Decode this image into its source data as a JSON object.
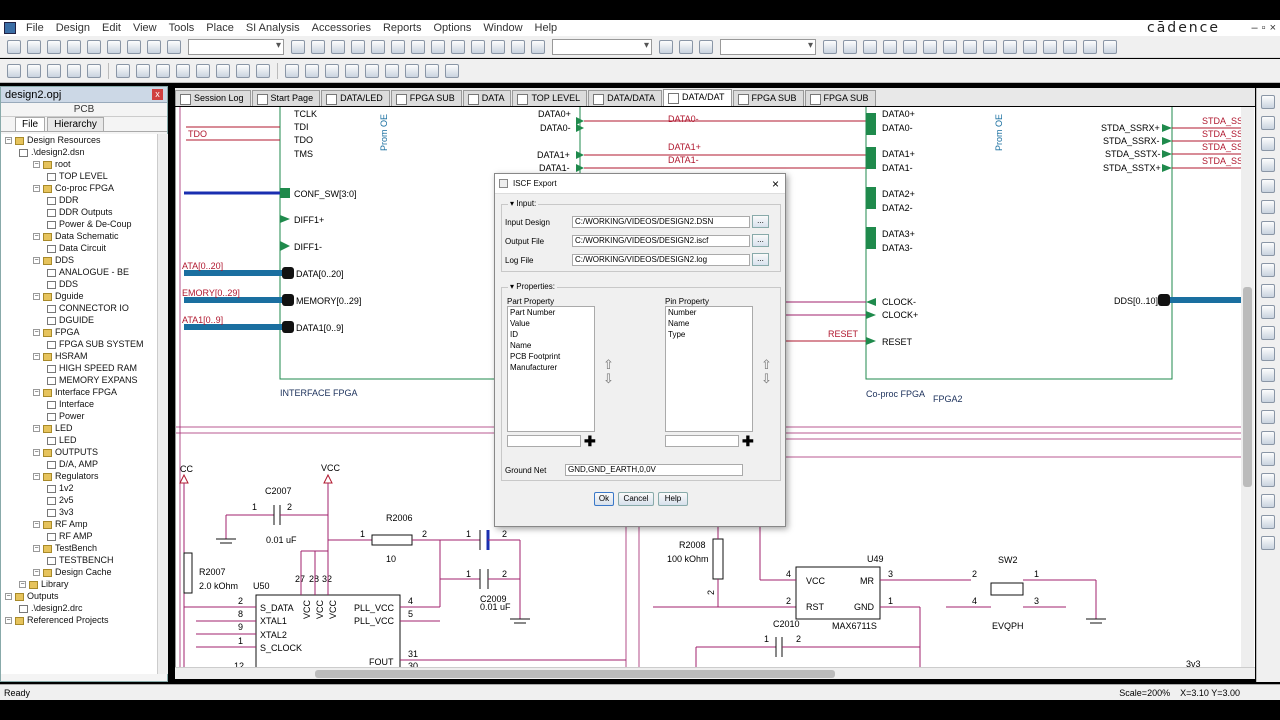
{
  "menu": {
    "items": [
      "File",
      "Design",
      "Edit",
      "View",
      "Tools",
      "Place",
      "SI Analysis",
      "Accessories",
      "Reports",
      "Options",
      "Window",
      "Help"
    ],
    "brand": "cādence"
  },
  "project": {
    "title": "design2.opj",
    "subtitle": "PCB",
    "tabs": [
      "File",
      "Hierarchy"
    ],
    "tree": [
      {
        "indent": 0,
        "label": "Design Resources",
        "icon": "folder"
      },
      {
        "indent": 1,
        "label": ".\\design2.dsn",
        "icon": "page"
      },
      {
        "indent": 2,
        "label": "root",
        "icon": "folder"
      },
      {
        "indent": 3,
        "label": "TOP LEVEL",
        "icon": "page"
      },
      {
        "indent": 2,
        "label": "Co-proc FPGA",
        "icon": "folder"
      },
      {
        "indent": 3,
        "label": "DDR",
        "icon": "page"
      },
      {
        "indent": 3,
        "label": "DDR Outputs",
        "icon": "page"
      },
      {
        "indent": 3,
        "label": "Power & De-Coup",
        "icon": "page"
      },
      {
        "indent": 2,
        "label": "Data Schematic",
        "icon": "folder"
      },
      {
        "indent": 3,
        "label": "Data Circuit",
        "icon": "page"
      },
      {
        "indent": 2,
        "label": "DDS",
        "icon": "folder"
      },
      {
        "indent": 3,
        "label": "ANALOGUE -  BE",
        "icon": "page"
      },
      {
        "indent": 3,
        "label": "DDS",
        "icon": "page"
      },
      {
        "indent": 2,
        "label": "Dguide",
        "icon": "folder"
      },
      {
        "indent": 3,
        "label": "CONNECTOR IO",
        "icon": "page"
      },
      {
        "indent": 3,
        "label": "DGUIDE",
        "icon": "page"
      },
      {
        "indent": 2,
        "label": "FPGA",
        "icon": "folder"
      },
      {
        "indent": 3,
        "label": "FPGA SUB SYSTEM",
        "icon": "page"
      },
      {
        "indent": 2,
        "label": "HSRAM",
        "icon": "folder"
      },
      {
        "indent": 3,
        "label": "HIGH SPEED RAM",
        "icon": "page"
      },
      {
        "indent": 3,
        "label": "MEMORY EXPANS",
        "icon": "page"
      },
      {
        "indent": 2,
        "label": "Interface FPGA",
        "icon": "folder"
      },
      {
        "indent": 3,
        "label": "Interface",
        "icon": "page"
      },
      {
        "indent": 3,
        "label": "Power",
        "icon": "page"
      },
      {
        "indent": 2,
        "label": "LED",
        "icon": "folder"
      },
      {
        "indent": 3,
        "label": "LED",
        "icon": "page"
      },
      {
        "indent": 2,
        "label": "OUTPUTS",
        "icon": "folder"
      },
      {
        "indent": 3,
        "label": "D/A, AMP",
        "icon": "page"
      },
      {
        "indent": 2,
        "label": "Regulators",
        "icon": "folder"
      },
      {
        "indent": 3,
        "label": "1v2",
        "icon": "page"
      },
      {
        "indent": 3,
        "label": "2v5",
        "icon": "page"
      },
      {
        "indent": 3,
        "label": "3v3",
        "icon": "page"
      },
      {
        "indent": 2,
        "label": "RF Amp",
        "icon": "folder"
      },
      {
        "indent": 3,
        "label": "RF AMP",
        "icon": "page"
      },
      {
        "indent": 2,
        "label": "TestBench",
        "icon": "folder"
      },
      {
        "indent": 3,
        "label": "TESTBENCH",
        "icon": "page"
      },
      {
        "indent": 2,
        "label": "Design Cache",
        "icon": "folder"
      },
      {
        "indent": 1,
        "label": "Library",
        "icon": "folder"
      },
      {
        "indent": 0,
        "label": "Outputs",
        "icon": "folder"
      },
      {
        "indent": 1,
        "label": ".\\design2.drc",
        "icon": "page"
      },
      {
        "indent": 0,
        "label": "Referenced Projects",
        "icon": "folder"
      }
    ]
  },
  "tabs": [
    "Session Log",
    "Start Page",
    "DATA/LED",
    "FPGA SUB",
    "DATA",
    "TOP LEVEL",
    "DATA/DATA",
    "DATA/DAT",
    "FPGA SUB",
    "FPGA SUB"
  ],
  "active_tab_index": 7,
  "schematic": {
    "left_block_pins": [
      "TCLK",
      "TDI",
      "TDO",
      "TMS"
    ],
    "left_block_nets": [
      "TDO"
    ],
    "left_pins2": [
      "CONF_SW[3:0]",
      "DIFF1+",
      "DIFF1-",
      "DATA[0..20]",
      "MEMORY[0..29]",
      "DATA1[0..9]"
    ],
    "left_bus_labels": [
      "ATA[0..20]",
      "EMORY[0..29]",
      "ATA1[0..9]"
    ],
    "left_block_name": "INTERFACE FPGA",
    "left_block_vlabel": "Prom OE",
    "mid_pins": [
      "DATA0+",
      "DATA0-",
      "DATA1+",
      "DATA1-"
    ],
    "mid_nets": [
      "DATA0-",
      "DATA1+",
      "DATA1-"
    ],
    "right_block_pins_left": [
      "DATA0+",
      "DATA0-",
      "DATA1+",
      "DATA1-",
      "DATA2+",
      "DATA2-",
      "DATA3+",
      "DATA3-",
      "CLOCK-",
      "CLOCK+",
      "RESET"
    ],
    "right_block_pins_right": [
      "STDA_SSRX+",
      "STDA_SSRX-",
      "STDA_SSTX-",
      "STDA_SSTX+",
      "DDS[0..10]"
    ],
    "right_nets": [
      "STDA_SS",
      "STDA_SS",
      "STDA_SS",
      "STDA_SS"
    ],
    "reset_net": "RESET",
    "right_block_name": "Co-proc FPGA",
    "right_block_ref": "FPGA2",
    "right_block_vlabel": "Prom OE",
    "c2007": {
      "ref": "C2007",
      "value": "0.01 uF",
      "pin1": "1",
      "pin2": "2"
    },
    "vcc_labels": [
      "VCC",
      "CC"
    ],
    "r2006": {
      "ref": "R2006",
      "value": "10",
      "pin1": "1",
      "pin2": "2"
    },
    "c2009": {
      "ref": "C2009",
      "value": "0.01 uF",
      "pin1": "1",
      "pin2": "2"
    },
    "r2007": {
      "ref": "R2007",
      "value": "2.0 kOhm"
    },
    "u50": {
      "ref": "U50",
      "pins_left": [
        "S_DATA",
        "XTAL1",
        "XTAL2",
        "S_CLOCK"
      ],
      "pin_nums_left": [
        "2",
        "8",
        "9",
        "1",
        "12"
      ],
      "vcc_pins": [
        "VCC",
        "VCC",
        "VCC"
      ],
      "vcc_nums": [
        "27",
        "28",
        "32"
      ],
      "pins_right": [
        "PLL_VCC",
        "PLL_VCC",
        "FOUT"
      ],
      "pin_nums_right": [
        "4",
        "5",
        "31",
        "30"
      ]
    },
    "r2008": {
      "ref": "R2008",
      "value": "100 kOhm",
      "pin": "2"
    },
    "u49": {
      "ref": "U49",
      "part": "MAX6711S",
      "pins_left": [
        "VCC",
        "RST"
      ],
      "pins_right": [
        "MR",
        "GND"
      ],
      "nums": [
        "4",
        "2",
        "3",
        "1"
      ]
    },
    "sw2": {
      "ref": "SW2",
      "part": "EVQPH",
      "nums": [
        "2",
        "1",
        "4",
        "3"
      ]
    },
    "c2010": {
      "ref": "C2010",
      "pin1": "1",
      "pin2": "2"
    },
    "corner_label": "3v3"
  },
  "dialog": {
    "title": "ISCF Export",
    "input_group": "Input:",
    "input_design_label": "Input Design",
    "input_design_value": "C:/WORKING/VIDEOS/DESIGN2.DSN",
    "output_file_label": "Output File",
    "output_file_value": "C:/WORKING/VIDEOS/DESIGN2.iscf",
    "log_file_label": "Log File",
    "log_file_value": "C:/WORKING/VIDEOS/DESIGN2.log",
    "browse_label": "...",
    "properties_group": "Properties:",
    "part_property_label": "Part Property",
    "part_properties": [
      "Part Number",
      "Value",
      "ID",
      "Name",
      "PCB Footprint",
      "Manufacturer"
    ],
    "pin_property_label": "Pin Property",
    "pin_properties": [
      "Number",
      "Name",
      "Type"
    ],
    "ground_net_label": "Ground Net",
    "ground_net_value": "GND,GND_EARTH,0,0V",
    "ok": "Ok",
    "cancel": "Cancel",
    "help": "Help"
  },
  "status": {
    "left": "Ready",
    "scale": "Scale=200%",
    "coords": "X=3.10  Y=3.00"
  },
  "colors": {
    "pin_green": "#1f8a4c",
    "net_red": "#b0182f",
    "bus_blue": "#1a6fa0",
    "wire_magenta": "#a0226c",
    "wire_blue": "#1a2fb0"
  }
}
